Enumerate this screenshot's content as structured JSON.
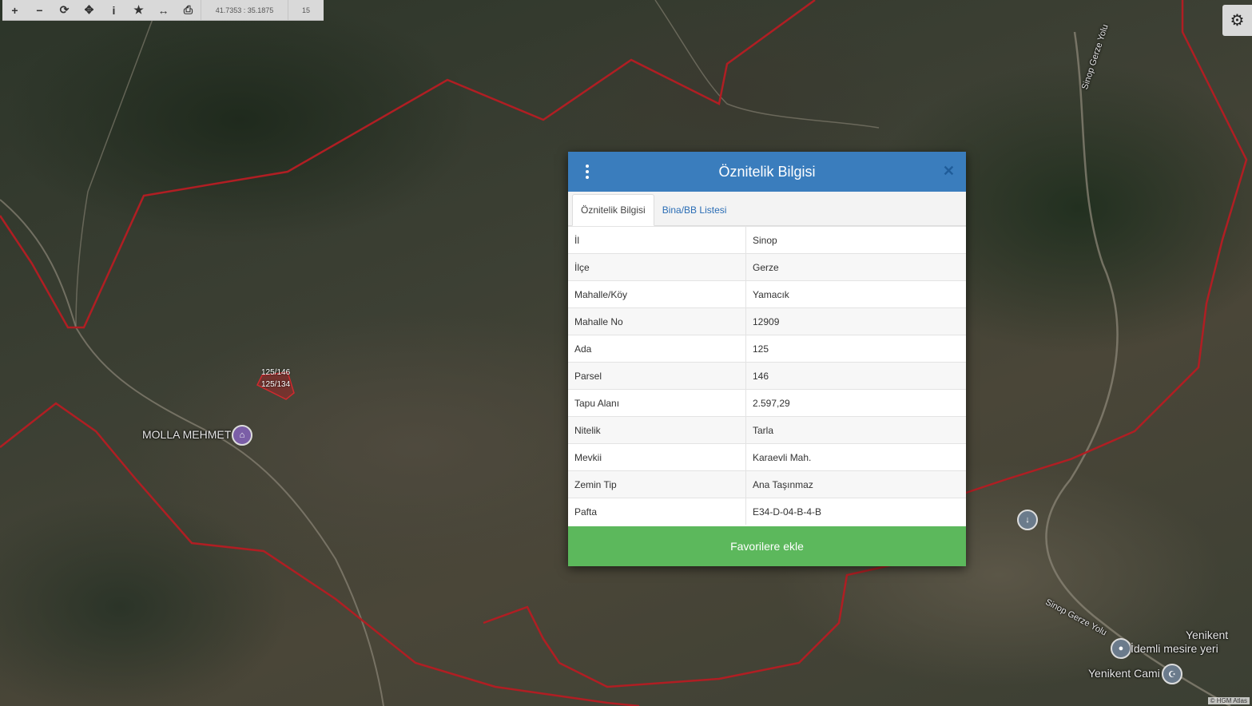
{
  "toolbar": {
    "zoom_in": "+",
    "zoom_out": "−",
    "refresh": "⟳",
    "move": "✥",
    "info": "i",
    "favorite": "★",
    "measure": "↔",
    "print": "⎙",
    "coordinates": "41.7353 : 35.1875",
    "zoom_level": "15"
  },
  "settings_icon": "⚙",
  "map": {
    "labels": {
      "village": "MOLLA MEHMET",
      "road1": "Sinop Gerze Yolu",
      "road2": "Sinop Gerze Yolu",
      "yenikent": "Yenikent",
      "idemli": "İdemli mesire yeri",
      "cami": "Yenikent Cami",
      "parcel1": "125/146",
      "parcel2": "125/134"
    },
    "attribution": "© HGM Atlas"
  },
  "dialog": {
    "title": "Öznitelik Bilgisi",
    "close": "✕",
    "tabs": [
      {
        "label": "Öznitelik Bilgisi"
      },
      {
        "label": "Bina/BB Listesi"
      }
    ],
    "rows": [
      {
        "key": "İl",
        "value": "Sinop"
      },
      {
        "key": "İlçe",
        "value": "Gerze"
      },
      {
        "key": "Mahalle/Köy",
        "value": "Yamacık"
      },
      {
        "key": "Mahalle No",
        "value": "12909"
      },
      {
        "key": "Ada",
        "value": "125"
      },
      {
        "key": "Parsel",
        "value": "146"
      },
      {
        "key": "Tapu Alanı",
        "value": "2.597,29"
      },
      {
        "key": "Nitelik",
        "value": "Tarla"
      },
      {
        "key": "Mevkii",
        "value": "Karaevli Mah."
      },
      {
        "key": "Zemin Tip",
        "value": "Ana Taşınmaz"
      },
      {
        "key": "Pafta",
        "value": "E34-D-04-B-4-B"
      }
    ],
    "favorite_button": "Favorilere ekle"
  },
  "colors": {
    "header": "#3a7dbd",
    "favorite": "#5cb85c",
    "boundary": "#b01e23"
  }
}
